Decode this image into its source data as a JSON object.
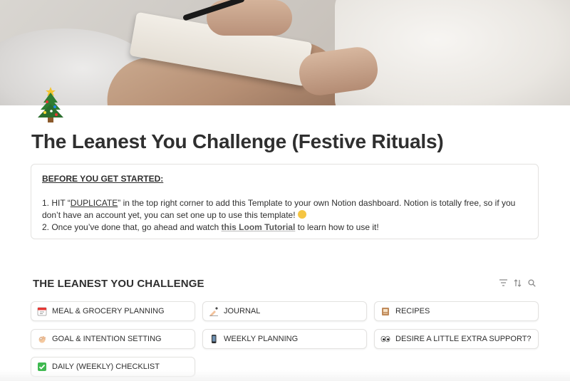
{
  "page": {
    "title": "The Leanest You Challenge (Festive Rituals)",
    "icon": "christmas-tree-icon"
  },
  "callout": {
    "heading": "BEFORE YOU GET STARTED:",
    "line1_prefix": "1. HIT “",
    "line1_emph": "DUPLICATE",
    "line1_rest": "” in the top right corner to add this Template to your own Notion dashboard. Notion is totally free, so if you don’t have an account yet, you can set one up to use this template! ",
    "line2_prefix": "2. Once you’ve done that, go ahead and watch ",
    "line2_link": "this Loom Tutorial",
    "line2_suffix": " to learn how to use it!"
  },
  "section": {
    "title": "THE LEANEST YOU CHALLENGE",
    "tools": [
      "filter-icon",
      "sort-icon",
      "search-icon"
    ]
  },
  "cards": [
    {
      "label": "MEAL & GROCERY PLANNING",
      "icon": "calendar-icon"
    },
    {
      "label": "JOURNAL",
      "icon": "writing-hand-icon"
    },
    {
      "label": "RECIPES",
      "icon": "cookbook-icon"
    },
    {
      "label": "GOAL & INTENTION SETTING",
      "icon": "ok-hand-icon"
    },
    {
      "label": "WEEKLY PLANNING",
      "icon": "phone-icon"
    },
    {
      "label": "DESIRE A LITTLE EXTRA SUPPORT?",
      "icon": "eyes-icon"
    },
    {
      "label": "DAILY (WEEKLY) CHECKLIST",
      "icon": "check-mark-icon"
    }
  ]
}
